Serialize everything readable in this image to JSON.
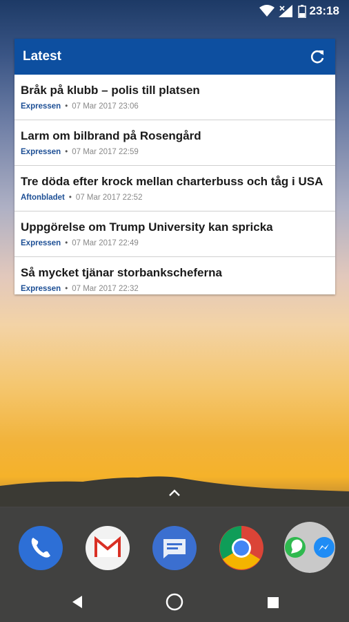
{
  "status_bar": {
    "time": "23:18",
    "icons": [
      "wifi-icon",
      "cell-signal-icon",
      "battery-icon"
    ]
  },
  "widget": {
    "title": "Latest",
    "refresh_icon": "refresh-icon",
    "header_color": "#0d4fa0",
    "items": [
      {
        "title": "Bråk på klubb – polis till platsen",
        "source": "Expressen",
        "date": "07 Mar 2017 23:06"
      },
      {
        "title": "Larm om bilbrand på Rosengård",
        "source": "Expressen",
        "date": "07 Mar 2017 22:59"
      },
      {
        "title": "Tre döda efter krock mellan charterbuss och tåg i USA",
        "source": "Aftonbladet",
        "date": "07 Mar 2017 22:52"
      },
      {
        "title": "Uppgörelse om Trump University kan spricka",
        "source": "Expressen",
        "date": "07 Mar 2017 22:49"
      },
      {
        "title": "Så mycket tjänar storbankscheferna",
        "source": "Expressen",
        "date": "07 Mar 2017 22:32"
      }
    ]
  },
  "dock": {
    "apps": [
      "phone-icon",
      "gmail-icon",
      "messages-icon",
      "chrome-icon",
      "whatsapp-messenger-folder-icon"
    ]
  },
  "navbar": {
    "buttons": [
      "back-icon",
      "home-icon",
      "recents-icon"
    ]
  }
}
